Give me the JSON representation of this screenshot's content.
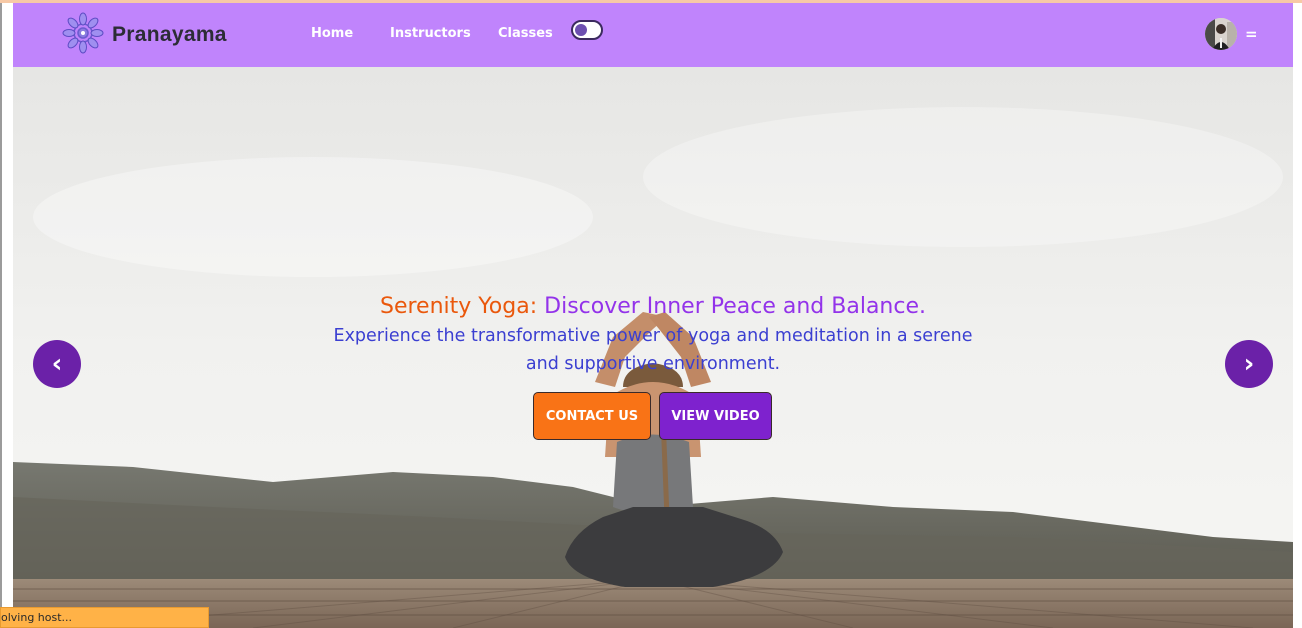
{
  "brand": {
    "name": "Pranayama",
    "icon": "mandala-logo-icon"
  },
  "nav": {
    "links": [
      {
        "label": "Home"
      },
      {
        "label": "Instructors"
      },
      {
        "label": "Classes"
      }
    ],
    "theme_toggle": {
      "state": "off"
    },
    "menu_label": "="
  },
  "hero": {
    "title_accent": "Serenity Yoga:",
    "title_main": "Discover Inner Peace and Balance.",
    "subtitle": "Experience the transformative power of yoga and meditation in a serene and supportive environment.",
    "buttons": {
      "contact": "CONTACT US",
      "video": "VIEW VIDEO"
    },
    "prev_arrow": "‹",
    "next_arrow": "›"
  },
  "status_bar": {
    "text": "olving host..."
  },
  "colors": {
    "navbar": "#c084fc",
    "title_accent": "#ea580c",
    "title_main": "#9333ea",
    "subtitle": "#3b3fd1",
    "contact_button": "#f97316",
    "video_button": "#7e22ce",
    "carousel_arrow": "#6b21a8",
    "status_bar": "#ffb247"
  }
}
